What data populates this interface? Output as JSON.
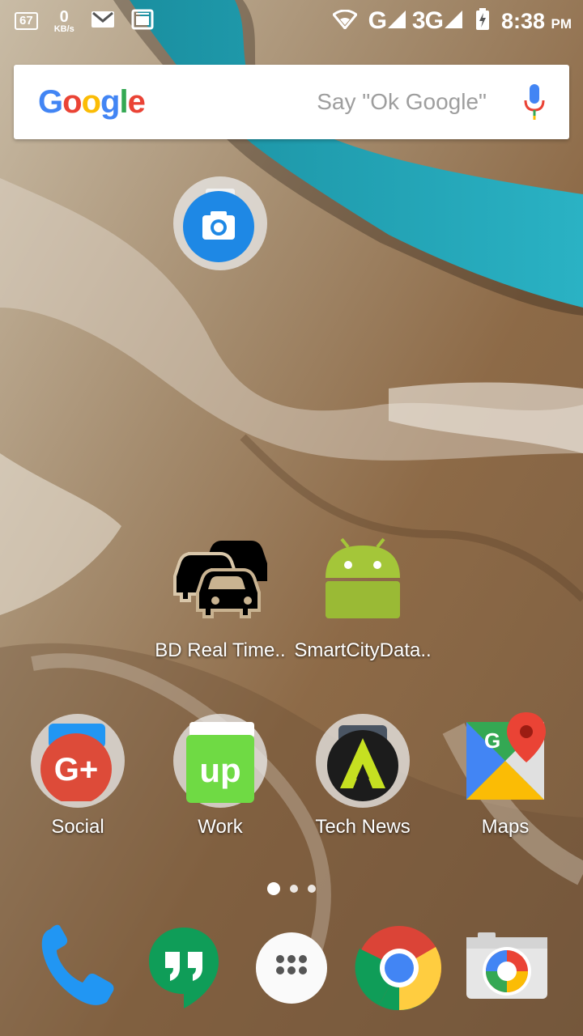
{
  "status_bar": {
    "battery_percent": "67",
    "net_speed_value": "0",
    "net_speed_unit": "KB/s",
    "signal1_label": "G",
    "signal2_label": "3G",
    "time": "8:38",
    "ampm": "PM",
    "icons": [
      "battery-icon",
      "gmail-icon",
      "news-icon",
      "wifi-icon",
      "signal-icon",
      "charging-battery-icon"
    ]
  },
  "search": {
    "logo": "Google",
    "hint": "Say \"Ok Google\""
  },
  "apps": {
    "camera_label": "",
    "bd_realtime": "BD Real Time..",
    "smartcity": "SmartCityData..",
    "social": "Social",
    "work": "Work",
    "tech_news": "Tech News",
    "maps": "Maps"
  },
  "pager": {
    "pages": 3,
    "current": 1
  },
  "dock": [
    "phone",
    "hangouts",
    "app-drawer",
    "chrome",
    "camera"
  ],
  "colors": {
    "google_blue": "#4285F4",
    "google_red": "#EA4335",
    "google_yellow": "#FBBC05",
    "google_green": "#34A853",
    "android_green": "#a4c639"
  }
}
